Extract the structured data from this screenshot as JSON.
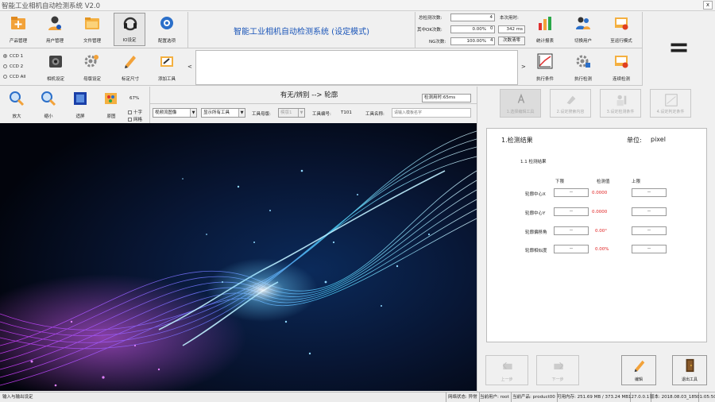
{
  "window": {
    "title": "智能工业相机自动检测系统 V2.0",
    "close_label": "x"
  },
  "toolbar_top": [
    {
      "label": "产品管理"
    },
    {
      "label": "用户管理"
    },
    {
      "label": "文件管理"
    },
    {
      "label": "IO设定"
    },
    {
      "label": "配置选项"
    }
  ],
  "header": {
    "system_title": "智能工业相机自动检测系统 (设定模式)"
  },
  "stats": {
    "total_label": "总检测次数:",
    "total_value": "4",
    "ok_label": "其中OK次数:",
    "ok_pct": "0.00%",
    "ok_count": "0",
    "ng_label": "NG次数:",
    "ng_pct": "100.00%",
    "ng_count": "4",
    "time_label": "本次用时:",
    "time_value": "342 ms",
    "clear_label": "次数清零"
  },
  "toolbar_right_top": [
    {
      "label": "统计报表"
    },
    {
      "label": "切换用户"
    },
    {
      "label": "至运行模式"
    }
  ],
  "ccd": [
    {
      "label": "CCD 1"
    },
    {
      "label": "CCD 2"
    },
    {
      "label": "CCD All"
    }
  ],
  "toolbar_second": [
    {
      "label": "相机设定"
    },
    {
      "label": "母版设定"
    },
    {
      "label": "标定尺寸"
    },
    {
      "label": "添加工具"
    }
  ],
  "scroll_left": "<",
  "scroll_right": ">",
  "toolbar_right_second": [
    {
      "label": "执行条件"
    },
    {
      "label": "执行检测"
    },
    {
      "label": "连续检测"
    }
  ],
  "menu_icon": "=",
  "view_tools": [
    {
      "label": "放大"
    },
    {
      "label": "缩小"
    },
    {
      "label": "适屏"
    },
    {
      "label": "原图"
    }
  ],
  "zoom": {
    "value": "67%",
    "cross_label": "十字",
    "grid_label": "网格"
  },
  "tool": {
    "title": "有无/辨别 --> 轮廓",
    "time_label": "检测用时:65ms",
    "image_mode": "视频流图像",
    "display_mode": "显示所有工具",
    "master_label": "工具母版:",
    "master_value": "模版1",
    "id_label": "工具编号:",
    "id_value": "T101",
    "name_label": "工具名称:",
    "name_placeholder": "请输入模板名字"
  },
  "steps": [
    {
      "label": "1.选择编辑工具"
    },
    {
      "label": "2.设定搜索内容"
    },
    {
      "label": "3.设定检测条件"
    },
    {
      "label": "4.设定判定条件"
    }
  ],
  "results": {
    "heading": "1.检测结果",
    "unit_label": "单位:",
    "unit_value": "pixel",
    "sub_heading": "1.1 检测结果",
    "col_lower": "下限",
    "col_measured": "检测值",
    "col_upper": "上限",
    "rows": [
      {
        "name": "轮廓中心X",
        "lower": "--",
        "value": "0.0000",
        "upper": "--"
      },
      {
        "name": "轮廓中心Y",
        "lower": "--",
        "value": "0.0000",
        "upper": "--"
      },
      {
        "name": "轮廓偏移角",
        "lower": "--",
        "value": "0.00°",
        "upper": "--"
      },
      {
        "name": "轮廓相似度",
        "lower": "--",
        "value": "0.00%",
        "upper": "--"
      }
    ]
  },
  "nav": {
    "prev": "上一步",
    "next": "下一步",
    "edit": "编辑",
    "exit": "退出工具"
  },
  "statusbar": {
    "left": "输入与输出设定",
    "net": "网络状态: 异常",
    "user": "当前用户: root",
    "product": "当前产品: product00",
    "memory": "可用内存: 251.69 MB / 373.24 MB",
    "ip": "127.0.0.1",
    "version": "版本: 2018.08.03_185",
    "clock": "01:05:50"
  },
  "colors": {
    "accent": "#1a55b8",
    "danger": "#e02020"
  }
}
